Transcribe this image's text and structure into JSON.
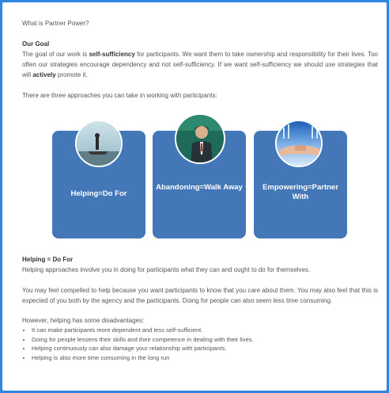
{
  "intro": {
    "question": "What is Partner Power?",
    "goal_heading": "Our Goal",
    "goal_text_1": "The goal of our work is ",
    "goal_bold_1": "self-sufficiency",
    "goal_text_2": " for participants. We want them to take ownership and responsibility for their lives. Too often our strategies encourage dependency and not self-sufficiency. If we want self-sufficiency we should use strategies that will ",
    "goal_bold_2": "actively",
    "goal_text_3": " promote it.",
    "approaches": "There are three approaches you can take in working with participants:"
  },
  "cards": [
    {
      "title": "Helping=Do For"
    },
    {
      "title": "Abandoning=Walk Away"
    },
    {
      "title": "Empowering=Partner With"
    }
  ],
  "helping": {
    "heading": "Helping = Do For",
    "desc": "Helping approaches involve you in doing for participants what they can and ought to do for themselves.",
    "para2": "You may feel compelled to help because you want participants to know that you care about them. You may also feel that this is expected of you both by the agency and the participants. Doing for people can also seem less time consuming.",
    "disadv": "However, helping has some disadvantages:",
    "bullets": [
      "It can make participants more dependent and less self-sufficient.",
      "Doing for people lessens their skills and their competence in dealing with their lives.",
      "Helping continuously can also damage your relationship with participants.",
      "Helping is also more time consuming in the long run"
    ]
  }
}
